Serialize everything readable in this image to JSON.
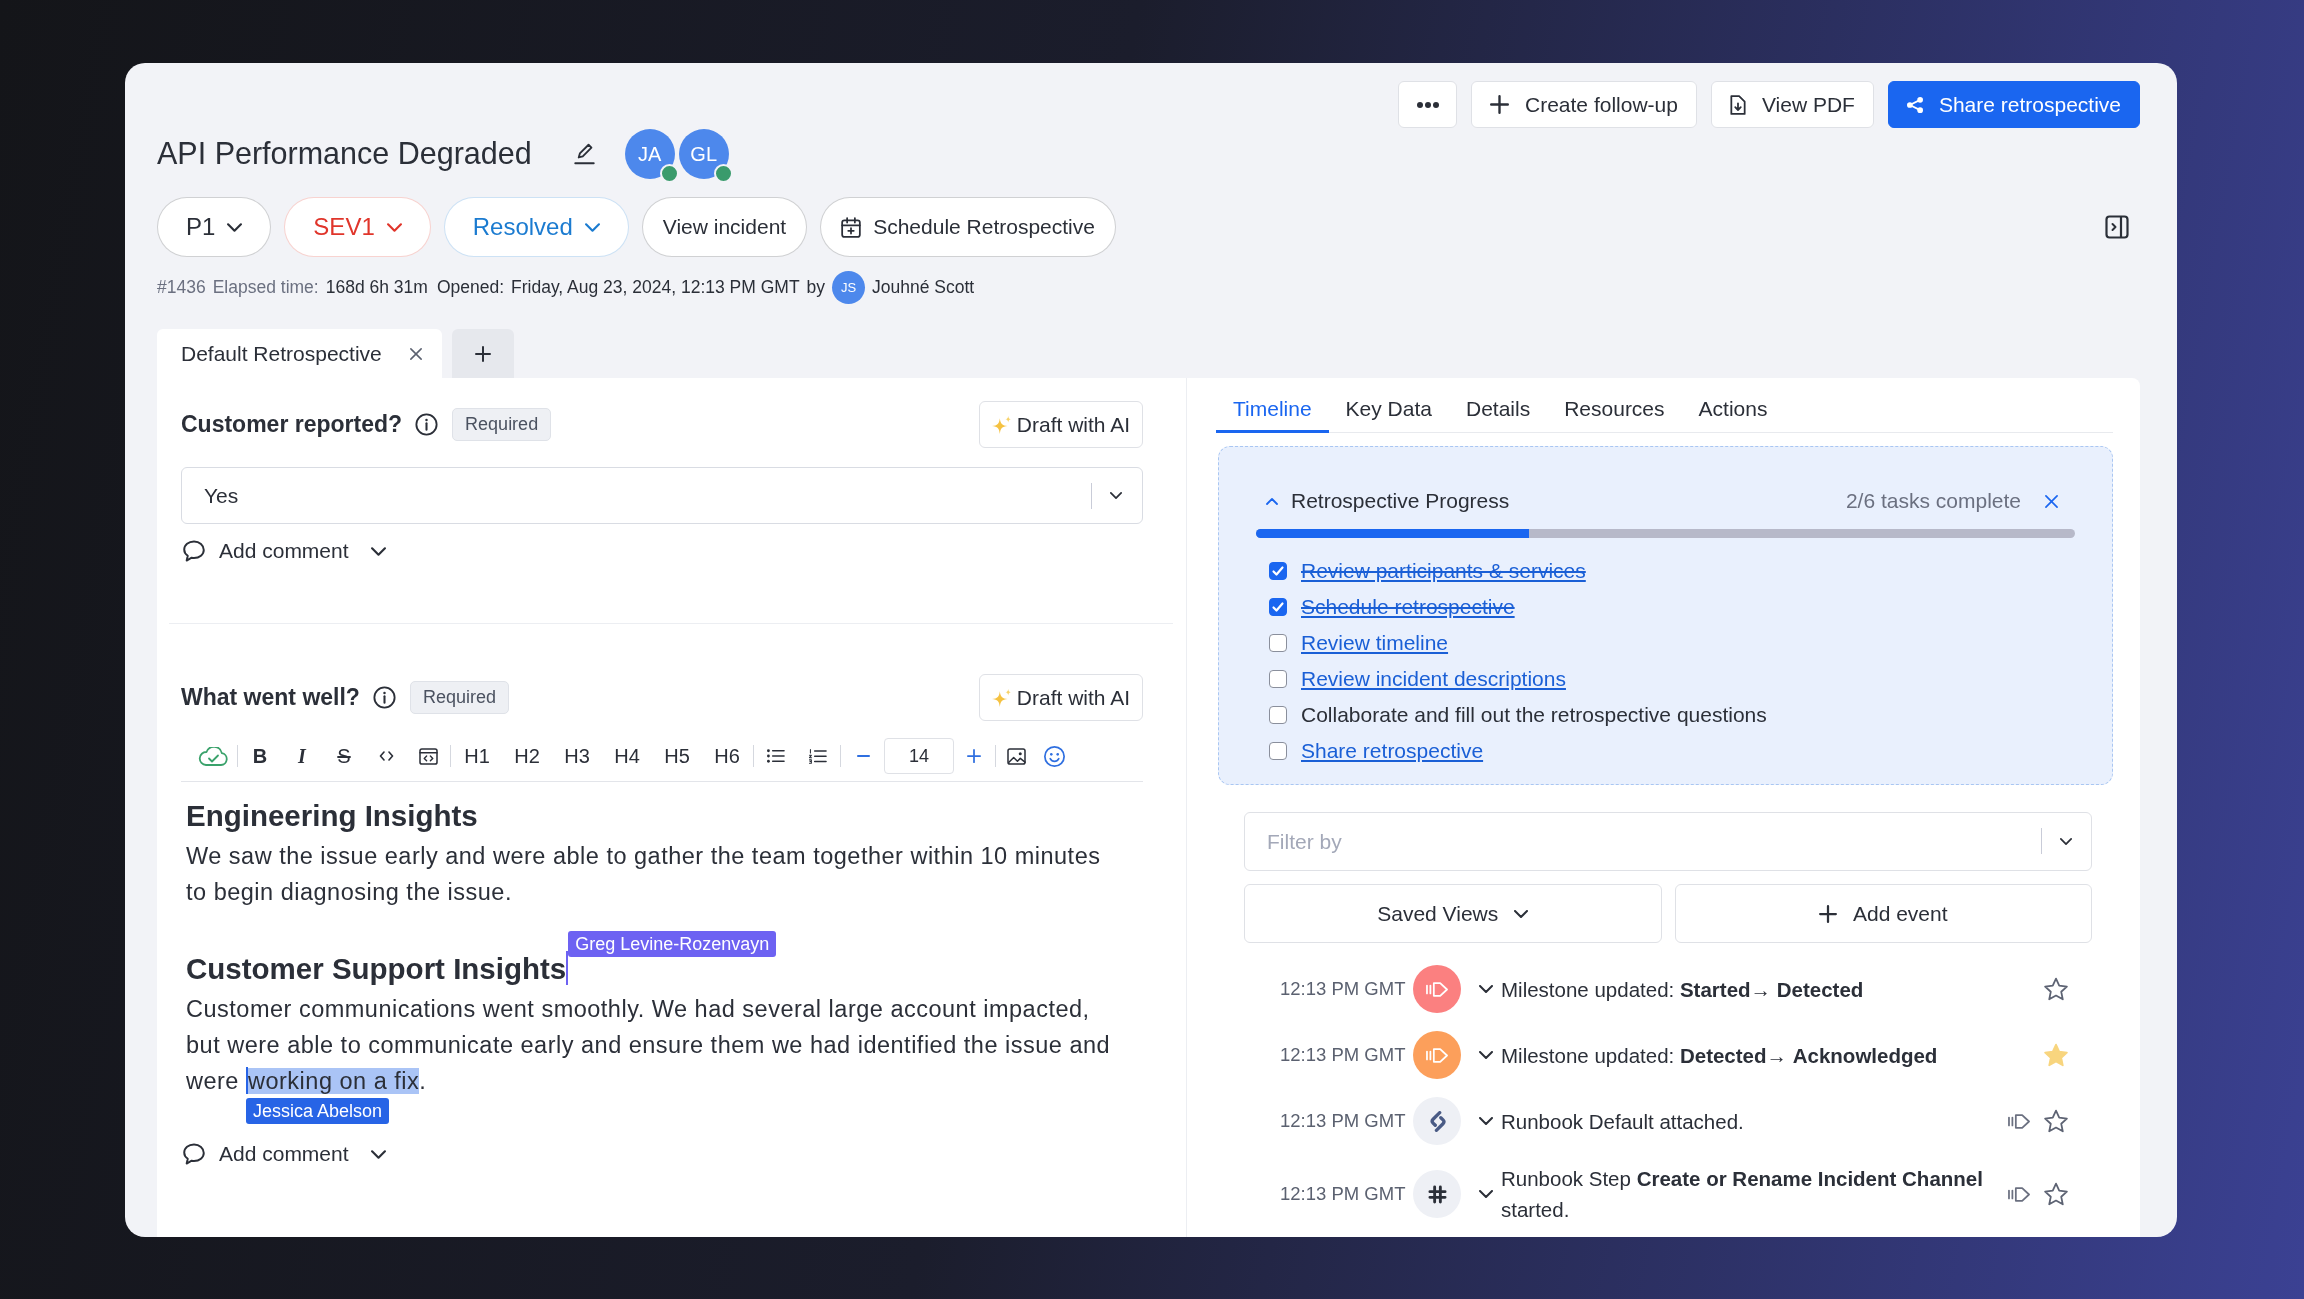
{
  "header": {
    "actions": [
      {
        "kind": "more",
        "primary": false
      },
      {
        "kind": "create",
        "label": "Create follow-up",
        "primary": false
      },
      {
        "kind": "pdf",
        "label": "View PDF",
        "primary": false
      },
      {
        "kind": "share",
        "label": "Share retrospective",
        "primary": true
      }
    ],
    "title": "API Performance Degraded",
    "avatars": [
      {
        "initials": "JA",
        "online": true
      },
      {
        "initials": "GL",
        "online": true
      }
    ],
    "pills": [
      {
        "kind": "dropdown",
        "label": "P1",
        "color": "#2b2f38"
      },
      {
        "kind": "dropdown",
        "label": "SEV1",
        "color": "#e0352b"
      },
      {
        "kind": "dropdown",
        "label": "Resolved",
        "color": "#1b7bd0"
      },
      {
        "kind": "button",
        "label": "View incident",
        "color": "#2b2f38"
      },
      {
        "kind": "calendar",
        "label": "Schedule Retrospective",
        "color": "#2b2f38"
      }
    ],
    "meta": {
      "number": "#1436",
      "elapsed_label": "Elapsed time:",
      "elapsed": "168d 6h 31m",
      "opened_label": "Opened:",
      "opened": "Friday, Aug 23, 2024, 12:13 PM GMT",
      "by": "by",
      "author_initials": "JS",
      "author": "Jouhné Scott"
    }
  },
  "retro_tabs": {
    "tabs": [
      {
        "label": "Default Retrospective",
        "selected": true
      }
    ]
  },
  "questions": [
    {
      "kind": "select",
      "label": "Customer reported?",
      "badge": "Required",
      "ai_button": "Draft with AI",
      "value": "Yes",
      "comment_button": "Add comment"
    },
    {
      "kind": "editor",
      "label": "What went well?",
      "badge": "Required",
      "ai_button": "Draft with AI",
      "toolbar": [
        {
          "kind": "cloud"
        },
        {
          "kind": "divider"
        },
        {
          "kind": "bold",
          "text": "B"
        },
        {
          "kind": "italic",
          "text": "I"
        },
        {
          "kind": "strike",
          "text": "S"
        },
        {
          "kind": "code"
        },
        {
          "kind": "codeblock"
        },
        {
          "kind": "divider"
        },
        {
          "kind": "heading",
          "text": "H1"
        },
        {
          "kind": "heading",
          "text": "H2"
        },
        {
          "kind": "heading",
          "text": "H3"
        },
        {
          "kind": "heading",
          "text": "H4"
        },
        {
          "kind": "heading",
          "text": "H5"
        },
        {
          "kind": "heading",
          "text": "H6"
        },
        {
          "kind": "divider"
        },
        {
          "kind": "bullets"
        },
        {
          "kind": "numbers"
        },
        {
          "kind": "divider"
        },
        {
          "kind": "decrease"
        },
        {
          "kind": "size",
          "value": "14"
        },
        {
          "kind": "increase"
        },
        {
          "kind": "divider"
        },
        {
          "kind": "image"
        },
        {
          "kind": "emoji"
        }
      ],
      "content": [
        {
          "kind": "heading",
          "segments": [
            {
              "kind": "text",
              "text": "Engineering Insights",
              "highlighted": false
            }
          ]
        },
        {
          "kind": "paragraph",
          "segments": [
            {
              "kind": "text",
              "text": "We saw the issue early and were able to gather the team together within 10 minutes to begin diagnosing the issue.",
              "highlighted": false
            }
          ]
        },
        {
          "kind": "heading",
          "segments": [
            {
              "kind": "text",
              "text": "Customer Support Insights",
              "highlighted": false
            },
            {
              "kind": "cursor",
              "name": "Greg Levine-Rozenvayn",
              "color": "#6d62f2"
            }
          ]
        },
        {
          "kind": "paragraph",
          "segments": [
            {
              "kind": "text",
              "text": "Customer communications went smoothly. We had several large account impacted, but were able to communicate early and ensure them we had identified the issue and were ",
              "highlighted": false
            },
            {
              "kind": "cursor",
              "name": "Jessica Abelson",
              "color": "#2764e6"
            },
            {
              "kind": "text",
              "text": "working on a fix",
              "highlighted": true
            },
            {
              "kind": "text",
              "text": ".",
              "highlighted": false
            }
          ]
        }
      ],
      "comment_button": "Add comment"
    }
  ],
  "side_panel": {
    "tabs": [
      {
        "label": "Timeline",
        "selected": true
      },
      {
        "label": "Key Data",
        "selected": false
      },
      {
        "label": "Details",
        "selected": false
      },
      {
        "label": "Resources",
        "selected": false
      },
      {
        "label": "Actions",
        "selected": false
      }
    ],
    "progress": {
      "title": "Retrospective Progress",
      "expanded": true,
      "summary": "2/6 tasks complete",
      "level": 0.333,
      "tasks": [
        {
          "kind": "link",
          "text": "Review participants & services",
          "checked": true
        },
        {
          "kind": "link",
          "text": "Schedule retrospective",
          "checked": true
        },
        {
          "kind": "link",
          "text": "Review timeline",
          "checked": false
        },
        {
          "kind": "link",
          "text": "Review incident descriptions",
          "checked": false
        },
        {
          "kind": "text",
          "text": "Collaborate and fill out the retrospective questions",
          "checked": false
        },
        {
          "kind": "link",
          "text": "Share retrospective",
          "checked": false
        }
      ]
    },
    "filter": {
      "placeholder": "Filter by"
    },
    "buttons": [
      {
        "kind": "views",
        "label": "Saved Views"
      },
      {
        "kind": "add",
        "label": "Add event"
      }
    ],
    "events": [
      {
        "time": "12:13 PM GMT",
        "kind": "milestone",
        "color": "#fb8080",
        "text": "Milestone updated: **Started**→ **Detected**",
        "milestone_action": false,
        "starred": false
      },
      {
        "time": "12:13 PM GMT",
        "kind": "milestone",
        "color": "#fc9f5b",
        "text": "Milestone updated: **Detected**→ **Acknowledged**",
        "milestone_action": false,
        "starred": true
      },
      {
        "time": "12:13 PM GMT",
        "kind": "runbook",
        "color": "#eef0f5",
        "text": "Runbook Default attached.",
        "milestone_action": true,
        "starred": false
      },
      {
        "time": "12:13 PM GMT",
        "kind": "chat",
        "color": "#eef0f5",
        "text": "Runbook Step **Create or Rename Incident Channel** started.",
        "milestone_action": true,
        "starred": false
      }
    ]
  }
}
